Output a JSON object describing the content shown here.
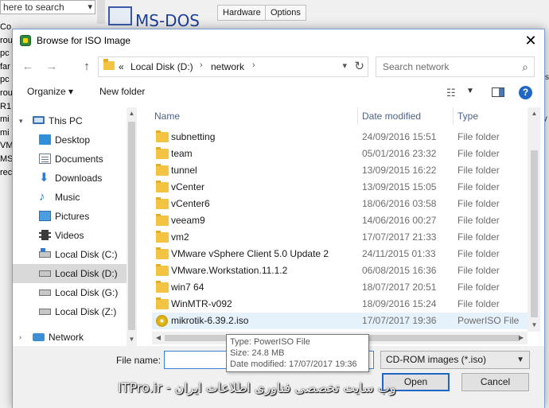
{
  "background_app": {
    "search_text": "here to search",
    "left_list": [
      "Co",
      "rou",
      "pc",
      "far",
      "pc",
      "rou",
      "R1",
      "mi",
      "mi",
      "VM",
      "MS",
      "rec"
    ],
    "logo_text": "MS-DOS",
    "tabs": [
      "Hardware",
      "Options"
    ],
    "right_strip": [
      "×",
      "×",
      "ys",
      "",
      "ty"
    ]
  },
  "dialog": {
    "title": "Browse for ISO Image",
    "close_label": "✕"
  },
  "navbar": {
    "back_label": "←",
    "forward_label": "→",
    "up_label": "↑",
    "path": [
      "«",
      "Local Disk  (D:)",
      "network"
    ],
    "path_sep": "›",
    "refresh_label": "↻",
    "search_placeholder": "Search network",
    "search_icon": "⌕"
  },
  "toolbar": {
    "organize": "Organize ▾",
    "new_folder": "New folder",
    "help": "?"
  },
  "nav_pane": {
    "items": [
      {
        "label": "This PC",
        "icon": "pc-icon"
      },
      {
        "label": "Desktop",
        "icon": "desktop-icon"
      },
      {
        "label": "Documents",
        "icon": "documents-icon"
      },
      {
        "label": "Downloads",
        "icon": "downloads-icon"
      },
      {
        "label": "Music",
        "icon": "music-icon"
      },
      {
        "label": "Pictures",
        "icon": "pictures-icon"
      },
      {
        "label": "Videos",
        "icon": "videos-icon"
      },
      {
        "label": "Local Disk (C:)",
        "icon": "disk-icon"
      },
      {
        "label": "Local Disk  (D:)",
        "icon": "disk-icon",
        "selected": true
      },
      {
        "label": "Local Disk  (G:)",
        "icon": "disk-icon"
      },
      {
        "label": "Local Disk  (Z:)",
        "icon": "disk-icon"
      },
      {
        "label": "Network",
        "icon": "network-icon"
      }
    ]
  },
  "columns": {
    "name": "Name",
    "date": "Date modified",
    "type": "Type"
  },
  "files": [
    {
      "name": "subnetting",
      "date": "24/09/2016 15:51",
      "type": "File folder",
      "kind": "folder"
    },
    {
      "name": "team",
      "date": "05/01/2016 23:32",
      "type": "File folder",
      "kind": "folder"
    },
    {
      "name": "tunnel",
      "date": "13/09/2015 16:22",
      "type": "File folder",
      "kind": "folder"
    },
    {
      "name": "vCenter",
      "date": "13/09/2015 15:05",
      "type": "File folder",
      "kind": "folder"
    },
    {
      "name": "vCenter6",
      "date": "18/06/2016 03:58",
      "type": "File folder",
      "kind": "folder"
    },
    {
      "name": "veeam9",
      "date": "14/06/2016 00:27",
      "type": "File folder",
      "kind": "folder"
    },
    {
      "name": "vm2",
      "date": "17/07/2017 21:33",
      "type": "File folder",
      "kind": "folder"
    },
    {
      "name": "VMware vSphere Client 5.0 Update 2",
      "date": "24/11/2015 01:33",
      "type": "File folder",
      "kind": "folder"
    },
    {
      "name": "VMware.Workstation.11.1.2",
      "date": "06/08/2015 16:36",
      "type": "File folder",
      "kind": "folder"
    },
    {
      "name": "win7 64",
      "date": "18/07/2017 20:51",
      "type": "File folder",
      "kind": "folder"
    },
    {
      "name": "WinMTR-v092",
      "date": "18/09/2016 15:24",
      "type": "File folder",
      "kind": "folder"
    },
    {
      "name": "mikrotik-6.39.2.iso",
      "date": "17/07/2017 19:36",
      "type": "PowerISO File",
      "kind": "iso",
      "highlight": true
    }
  ],
  "footer": {
    "file_name_label": "File name:",
    "file_name_value": "",
    "filter": "CD-ROM images (*.iso)",
    "open": "Open",
    "cancel": "Cancel"
  },
  "tooltip": {
    "type": "Type: PowerISO File",
    "size": "Size: 24.8 MB",
    "date": "Date modified: 17/07/2017 19:36"
  },
  "watermark": "وب سایت تخصصی فناوری اطلاعات ایران - ITPro.ir"
}
